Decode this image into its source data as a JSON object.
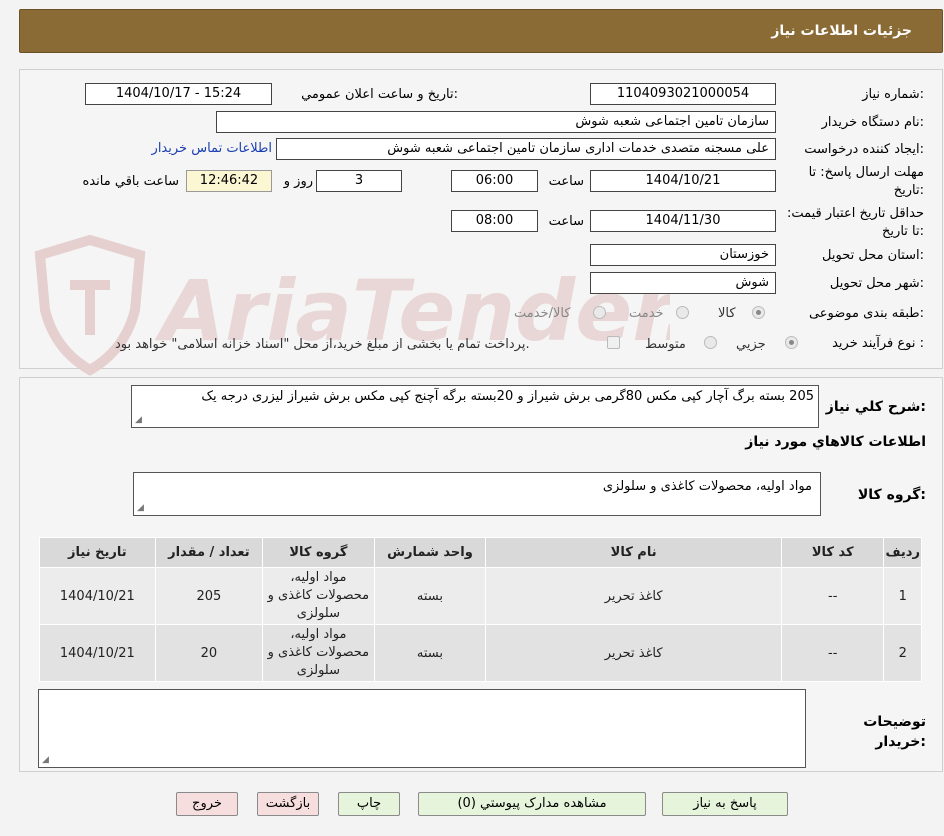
{
  "header": {
    "title": "جزئیات اطلاعات نیاز"
  },
  "watermark": {
    "text": "AriaTender.neT"
  },
  "form": {
    "need_number_label": "شماره نیاز:",
    "need_number": "1104093021000054",
    "announce_label": "تاریخ و ساعت اعلان عمومي:",
    "announce_value": "1404/10/17 - 15:24",
    "buyer_org_label": "نام دستگاه خريدار:",
    "buyer_org": "سازمان تامین اجتماعی شعبه شوش",
    "requester_label": "ايجاد کننده درخواست:",
    "requester": "علی مسجنه متصدی خدمات اداری سازمان تامین اجتماعی شعبه شوش",
    "contact_link": "اطلاعات تماس خريدار",
    "deadline_label": "مهلت ارسال پاسخ: تا تاریخ:",
    "deadline_date": "1404/10/21",
    "time_label": "ساعت",
    "deadline_time": "06:00",
    "days_value": "3",
    "days_label": "روز و",
    "remaining_time": "12:46:42",
    "remaining_label": "ساعت باقي مانده",
    "validity_label": "حداقل تاریخ اعتبار قیمت: تا تاریخ:",
    "validity_date": "1404/11/30",
    "validity_time": "08:00",
    "province_label": "استان محل تحویل:",
    "province": "خوزستان",
    "city_label": "شهر محل تحویل:",
    "city": "شوش",
    "category_label": "طبقه بندی موضوعی:",
    "category_options": [
      "کالا",
      "خدمت",
      "کالا/خدمت"
    ],
    "process_label": "نوع فرآیند خرید :",
    "process_options": [
      "جزیي",
      "متوسط"
    ],
    "payment_note": "پرداخت تمام یا بخشی از مبلغ خرید،از محل \"اسناد خزانه اسلامی\" خواهد بود."
  },
  "description": {
    "label": "شرح کلي نياز:",
    "text": "205 بسته برگ آچار کپی مکس 80گرمی برش شیراز و 20بسته برگه آچنج کپی مکس برش شیراز لیزری درجه یک"
  },
  "goods": {
    "section_title": "اطلاعات کالاهاي مورد نياز",
    "group_label": "گروه کالا:",
    "group_value": "مواد اولیه، محصولات کاغذی و سلولزی",
    "columns": [
      "رديف",
      "کد کالا",
      "نام کالا",
      "واحد شمارش",
      "گروه کالا",
      "تعداد / مقدار",
      "تاریخ نیاز"
    ],
    "rows": [
      {
        "index": "1",
        "code": "--",
        "name": "کاغذ تحریر",
        "unit": "بسته",
        "group": "مواد اولیه، محصولات کاغذی و سلولزی",
        "qty": "205",
        "date": "1404/10/21"
      },
      {
        "index": "2",
        "code": "--",
        "name": "کاغذ تحریر",
        "unit": "بسته",
        "group": "مواد اولیه، محصولات کاغذی و سلولزی",
        "qty": "20",
        "date": "1404/10/21"
      }
    ]
  },
  "buyer_notes": {
    "label": "توضيحات خريدار:",
    "text": ""
  },
  "buttons": {
    "reply": "پاسخ به نياز",
    "attachments": "مشاهده مدارک پيوستي (0)",
    "print": "چاپ",
    "back": "بازگشت",
    "exit": "خروج"
  }
}
